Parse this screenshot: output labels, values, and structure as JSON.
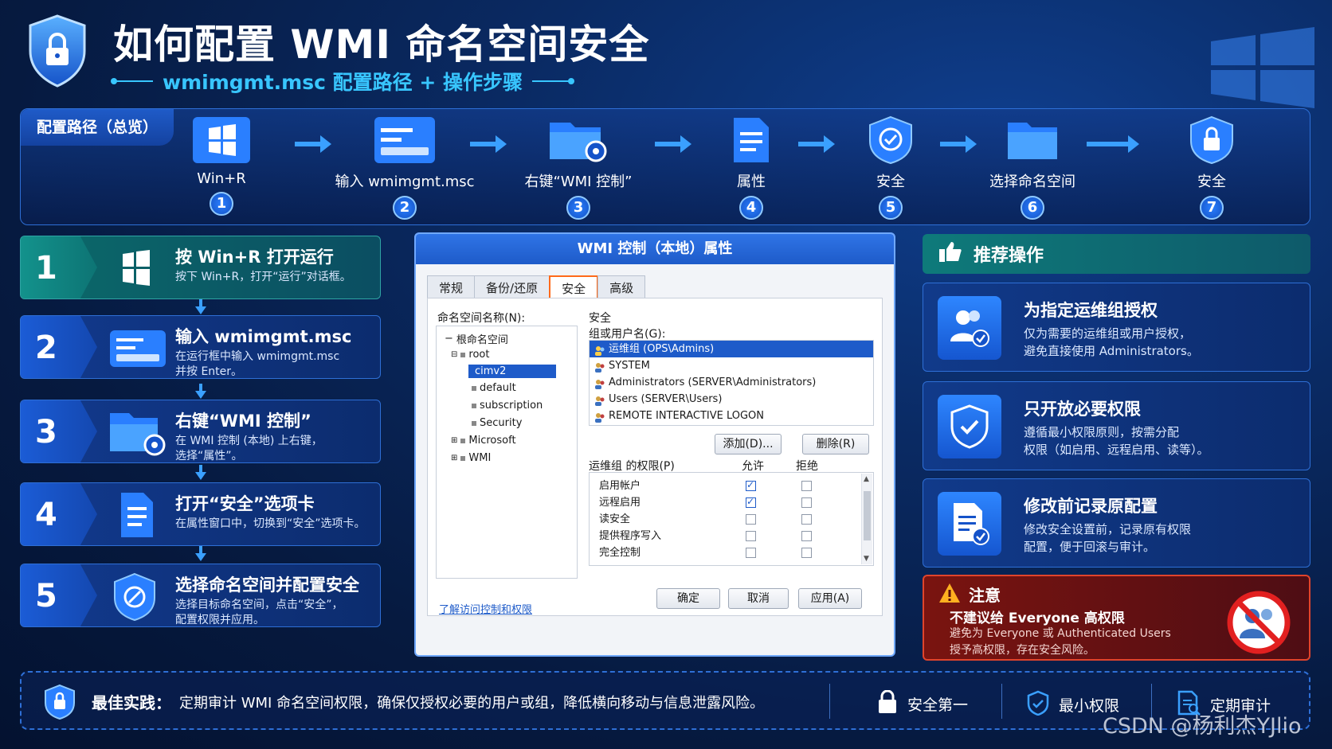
{
  "header": {
    "title": "如何配置 WMI 命名空间安全",
    "subtitle": "wmimgmt.msc 配置路径 + 操作步骤"
  },
  "path": {
    "tag": "配置路径（总览）",
    "steps": [
      {
        "label": "Win+R",
        "num": "1"
      },
      {
        "label": "输入 wmimgmt.msc",
        "num": "2"
      },
      {
        "label": "右键“WMI 控制”",
        "num": "3"
      },
      {
        "label": "属性",
        "num": "4"
      },
      {
        "label": "安全",
        "num": "5"
      },
      {
        "label": "选择命名空间",
        "num": "6"
      },
      {
        "label": "安全",
        "num": "7"
      }
    ]
  },
  "steps": [
    {
      "num": "1",
      "title": "按 Win+R 打开运行",
      "desc1": "按下 Win+R，打开“运行”对话框。",
      "desc2": ""
    },
    {
      "num": "2",
      "title": "输入 wmimgmt.msc",
      "desc1": "在运行框中输入 wmimgmt.msc",
      "desc2": "并按 Enter。"
    },
    {
      "num": "3",
      "title": "右键“WMI 控制”",
      "desc1": "在 WMI 控制 (本地) 上右键，",
      "desc2": "选择“属性”。"
    },
    {
      "num": "4",
      "title": "打开“安全”选项卡",
      "desc1": "在属性窗口中，切换到“安全”选项卡。",
      "desc2": ""
    },
    {
      "num": "5",
      "title": "选择命名空间并配置安全",
      "desc1": "选择目标命名空间，点击“安全”，",
      "desc2": "配置权限并应用。"
    }
  ],
  "dialog": {
    "title": "WMI 控制（本地）属性",
    "tabs": [
      "常规",
      "备份/还原",
      "安全",
      "高级"
    ],
    "namespace_label": "命名空间名称(N):",
    "tree": [
      "根命名空间",
      "root",
      "cimv2",
      "default",
      "subscription",
      "Security",
      "Microsoft",
      "WMI"
    ],
    "learn_link": "了解访问控制和权限",
    "security_label": "安全",
    "group_label": "组或用户名(G):",
    "users": [
      "运维组 (OPS\\Admins)",
      "SYSTEM",
      "Administrators (SERVER\\Administrators)",
      "Users (SERVER\\Users)",
      "REMOTE INTERACTIVE LOGON"
    ],
    "add_btn": "添加(D)...",
    "remove_btn": "删除(R)",
    "perm_label": "运维组 的权限(P)",
    "allow_label": "允许",
    "deny_label": "拒绝",
    "permissions": [
      {
        "name": "启用帐户",
        "allow": true,
        "deny": false
      },
      {
        "name": "远程启用",
        "allow": true,
        "deny": false
      },
      {
        "name": "读安全",
        "allow": false,
        "deny": false
      },
      {
        "name": "提供程序写入",
        "allow": false,
        "deny": false
      },
      {
        "name": "完全控制",
        "allow": false,
        "deny": false
      }
    ],
    "ok_btn": "确定",
    "cancel_btn": "取消",
    "apply_btn": "应用(A)"
  },
  "recommend": {
    "title": "推荐操作",
    "cards": [
      {
        "title": "为指定运维组授权",
        "desc1": "仅为需要的运维组或用户授权，",
        "desc2": "避免直接使用 Administrators。",
        "icon": "users-check-icon"
      },
      {
        "title": "只开放必要权限",
        "desc1": "遵循最小权限原则，按需分配",
        "desc2": "权限（如启用、远程启用、读等）。",
        "icon": "shield-check-icon"
      },
      {
        "title": "修改前记录原配置",
        "desc1": "修改安全设置前，记录原有权限",
        "desc2": "配置，便于回滚与审计。",
        "icon": "document-check-icon"
      }
    ]
  },
  "warning": {
    "title": "注意",
    "subtitle": "不建议给 Everyone 高权限",
    "desc1": "避免为 Everyone 或 Authenticated Users",
    "desc2": "授予高权限，存在安全风险。"
  },
  "footer": {
    "label": "最佳实践：",
    "text": "定期审计 WMI 命名空间权限，确保仅授权必要的用户或组，降低横向移动与信息泄露风险。",
    "items": [
      "安全第一",
      "最小权限",
      "定期审计"
    ]
  },
  "watermark": "CSDN @杨利杰YJlio",
  "colors": {
    "accent": "#38c6ff",
    "primary": "#1e5bc9",
    "teal": "#0e7a7a",
    "danger": "#e0442c"
  }
}
